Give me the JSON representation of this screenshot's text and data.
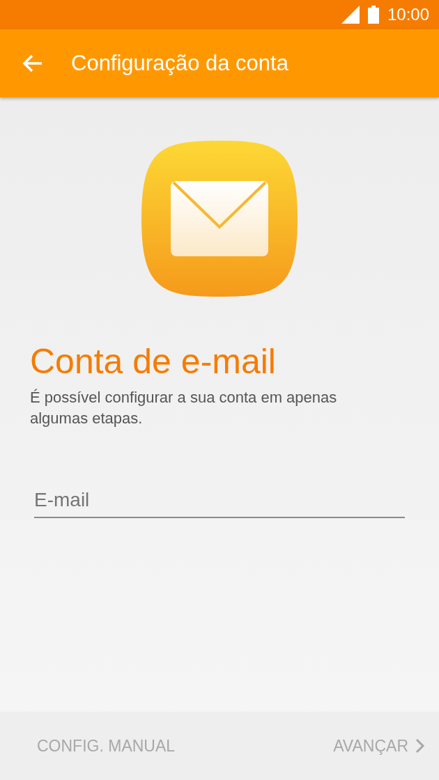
{
  "status_bar": {
    "time": "10:00"
  },
  "app_bar": {
    "title": "Configuração da conta"
  },
  "heading": "Conta de e-mail",
  "description": "É possível configurar a sua conta em apenas algumas etapas.",
  "email_field": {
    "placeholder": "E-mail"
  },
  "bottom_bar": {
    "buttons": [
      {
        "kind": "text",
        "label": "CONFIG. MANUAL",
        "disabled": true
      },
      {
        "kind": "next",
        "label": "AVANÇAR",
        "disabled": true
      }
    ]
  }
}
